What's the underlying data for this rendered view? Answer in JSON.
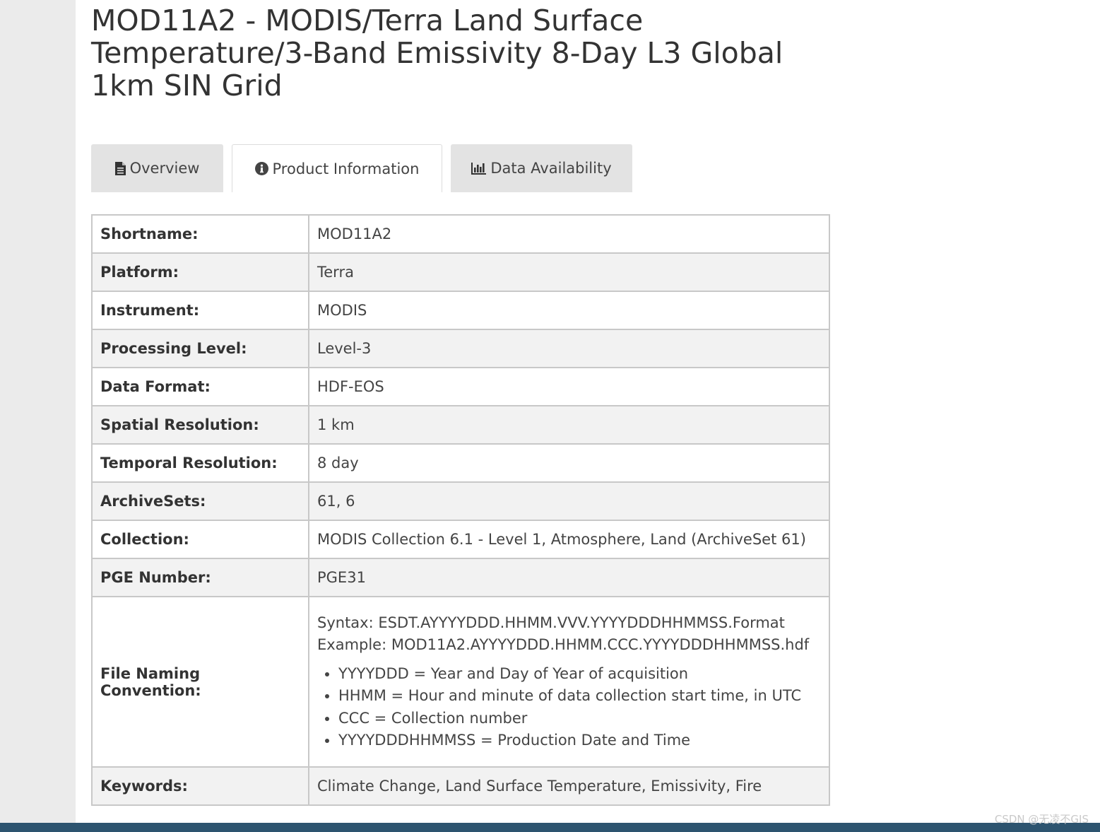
{
  "title": "MOD11A2 - MODIS/Terra Land Surface Temperature/3-Band Emissivity 8-Day L3 Global 1km SIN Grid",
  "tabs": [
    {
      "label": "Overview",
      "icon": "file-icon",
      "active": false
    },
    {
      "label": "Product Information",
      "icon": "info-circle-icon",
      "active": true
    },
    {
      "label": "Data Availability",
      "icon": "bar-chart-icon",
      "active": false
    }
  ],
  "rows": [
    {
      "key": "Shortname:",
      "value": "MOD11A2"
    },
    {
      "key": "Platform:",
      "value": "Terra"
    },
    {
      "key": "Instrument:",
      "value": "MODIS"
    },
    {
      "key": "Processing Level:",
      "value": "Level-3"
    },
    {
      "key": "Data Format:",
      "value": "HDF-EOS"
    },
    {
      "key": "Spatial Resolution:",
      "value": "1 km"
    },
    {
      "key": "Temporal Resolution:",
      "value": "8 day"
    },
    {
      "key": "ArchiveSets:",
      "value": "61, 6"
    },
    {
      "key": "Collection:",
      "value": "MODIS Collection 6.1 - Level 1, Atmosphere, Land (ArchiveSet 61)"
    },
    {
      "key": "PGE Number:",
      "value": "PGE31"
    }
  ],
  "file_naming": {
    "key": "File Naming Convention:",
    "syntax": "Syntax: ESDT.AYYYYDDD.HHMM.VVV.YYYYDDDHHMMSS.Format",
    "example": "Example: MOD11A2.AYYYYDDD.HHMM.CCC.YYYYDDDHHMMSS.hdf",
    "items": [
      "YYYYDDD = Year and Day of Year of acquisition",
      "HHMM = Hour and minute of data collection start time, in UTC",
      "CCC = Collection number",
      "YYYYDDDHHMMSS = Production Date and Time"
    ]
  },
  "keywords": {
    "key": "Keywords:",
    "value": "Climate Change, Land Surface Temperature, Emissivity, Fire"
  },
  "watermark": "CSDN @无凌不GIS",
  "colors": {
    "footer": "#2d546f",
    "gutter": "#ebebeb",
    "row_shade": "#f2f2f2"
  }
}
